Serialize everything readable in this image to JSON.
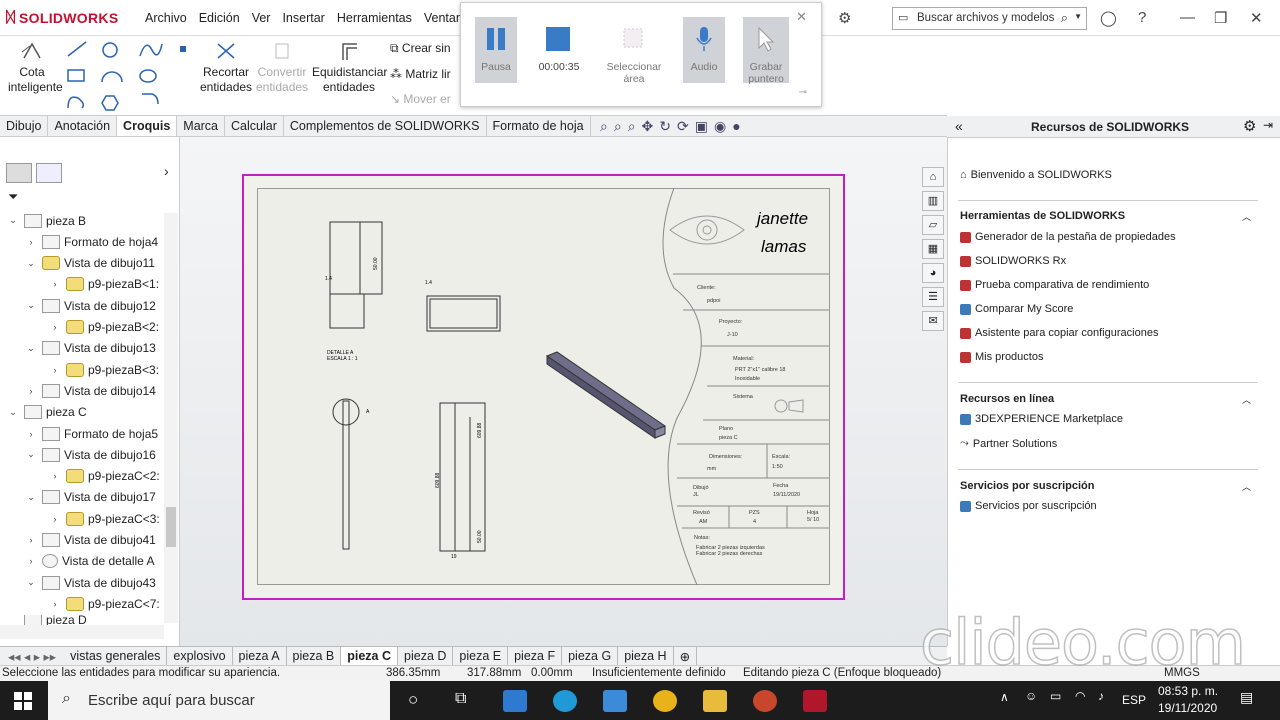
{
  "app": {
    "brand": "SOLIDWORKS"
  },
  "menu": [
    "Archivo",
    "Edición",
    "Ver",
    "Insertar",
    "Herramientas",
    "Ventana"
  ],
  "search": {
    "placeholder": "Buscar archivos y modelos"
  },
  "ribbon": {
    "cota": "Cota inteligente",
    "recortar": "Recortar entidades",
    "convertir": "Convertir entidades",
    "equidistanciar": "Equidistanciar entidades",
    "crear_simetria": "Crear sin",
    "matriz": "Matriz lir",
    "mover": "Mover er"
  },
  "recorder": {
    "pause": "Pausa",
    "time": "00:00:35",
    "select_area": "Seleccionar área",
    "audio": "Audio",
    "record_pointer": "Grabar puntero"
  },
  "command_tabs": [
    "Dibujo",
    "Anotación",
    "Croquis",
    "Marca",
    "Calcular",
    "Complementos de SOLIDWORKS",
    "Formato de hoja"
  ],
  "active_command_tab": "Croquis",
  "tree": [
    {
      "label": "pieza B",
      "level": 0,
      "icon": "sheet"
    },
    {
      "label": "Formato de hoja4",
      "level": 1,
      "icon": "sheet"
    },
    {
      "label": "Vista de dibujo11",
      "level": 1,
      "icon": "view-yellow"
    },
    {
      "label": "p9-piezaB<1:",
      "level": 2,
      "icon": "part"
    },
    {
      "label": "Vista de dibujo12",
      "level": 1,
      "icon": "view"
    },
    {
      "label": "p9-piezaB<2:",
      "level": 2,
      "icon": "part"
    },
    {
      "label": "Vista de dibujo13",
      "level": 1,
      "icon": "view"
    },
    {
      "label": "p9-piezaB<3:",
      "level": 2,
      "icon": "part"
    },
    {
      "label": "Vista de dibujo14",
      "level": 1,
      "icon": "view"
    },
    {
      "label": "pieza C",
      "level": 0,
      "icon": "sheet"
    },
    {
      "label": "Formato de hoja5",
      "level": 1,
      "icon": "sheet"
    },
    {
      "label": "Vista de dibujo16",
      "level": 1,
      "icon": "view"
    },
    {
      "label": "p9-piezaC<2:",
      "level": 2,
      "icon": "part"
    },
    {
      "label": "Vista de dibujo17",
      "level": 1,
      "icon": "view"
    },
    {
      "label": "p9-piezaC<3:",
      "level": 2,
      "icon": "part"
    },
    {
      "label": "Vista de dibujo41",
      "level": 1,
      "icon": "view"
    },
    {
      "label": "Vista de detalle A",
      "level": 1,
      "icon": "detail"
    },
    {
      "label": "Vista de dibujo43",
      "level": 1,
      "icon": "view"
    },
    {
      "label": "p9-piezaC<7:",
      "level": 2,
      "icon": "part"
    }
  ],
  "tree_partial": "pieza D",
  "drawing": {
    "signature_line1": "janette",
    "signature_line2": "lamas",
    "cliente_label": "Cliente:",
    "cliente": "pdpoi",
    "proyecto_label": "Proyecto:",
    "proyecto": "J-10",
    "material_label": "Material:",
    "material_1": "PRT 2\"x1\" calibre 18",
    "material_2": "Inoxidable",
    "sistema_label": "Sistema",
    "plano_label": "Plano",
    "plano": "pieza C",
    "dimensiones_label": "Dimensiones:",
    "dimensiones": "mm",
    "escala_label": "Escala:",
    "escala": "1:50",
    "dibujo_label": "Dibujó",
    "dibujo": "JL",
    "fecha_label": "Fecha",
    "fecha": "19/11/2020",
    "reviso_label": "Revisó",
    "reviso": "AM",
    "pzs_label": "PZS",
    "pzs": "4",
    "hoja_label": "Hoja",
    "hoja": "5/ 10",
    "notas_label": "Notas:",
    "nota_1": "Fabricar 2 piezas izquierdas",
    "nota_2": "Fabricar 2 piezas derechas",
    "detalle_1": "DETALLE A",
    "detalle_2": "ESCALA 1 : 1",
    "detail_marker": "A",
    "dim_50": "50.00",
    "dim_h1": "609.88",
    "dim_h2": "609.88",
    "dim_b": "50.00",
    "dim_tick1": "1.4",
    "dim_tick2": "1.4",
    "dim_tick3": "19"
  },
  "right_panel": {
    "title": "Recursos de SOLIDWORKS",
    "welcome": "Bienvenido a SOLIDWORKS",
    "tools_header": "Herramientas de SOLIDWORKS",
    "tools": [
      "Generador de la pestaña de propiedades",
      "SOLIDWORKS Rx",
      "Prueba comparativa de rendimiento",
      "Comparar My Score",
      "Asistente para copiar configuraciones",
      "Mis productos"
    ],
    "online_header": "Recursos en línea",
    "online": [
      "3DEXPERIENCE Marketplace",
      "Partner Solutions"
    ],
    "subs_header": "Servicios por suscripción",
    "subs": [
      "Servicios por suscripción"
    ]
  },
  "sheet_tabs": [
    "vistas generales",
    "explosivo",
    "pieza A",
    "pieza B",
    "pieza C",
    "pieza D",
    "pieza E",
    "pieza F",
    "pieza G",
    "pieza H"
  ],
  "active_sheet_tab": "pieza C",
  "status": {
    "hint": "Seleccione las entidades para modificar su apariencia.",
    "x": "386.35mm",
    "y": "317.88mm",
    "z": "0.00mm",
    "definition": "Insuficientemente definido",
    "editing": "Editando pieza C (Enfoque bloqueado)",
    "units": "MMGS"
  },
  "taskbar": {
    "search": "Escribe aquí para buscar",
    "lang": "ESP",
    "time": "08:53 p. m.",
    "date": "19/11/2020"
  },
  "watermark": "clideo.com",
  "colors": {
    "accent_red": "#c8102e",
    "sheet_border": "#c021c0",
    "recorder_blue": "#3a7bc8"
  }
}
